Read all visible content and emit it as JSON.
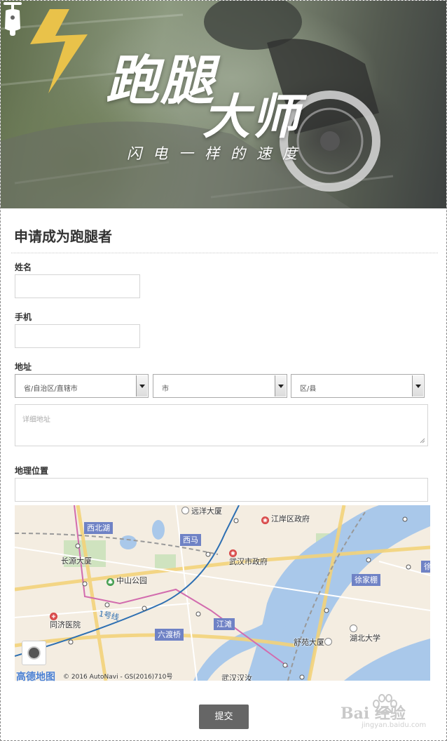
{
  "banner": {
    "title_line1": "跑腿",
    "title_line2": "大师",
    "slogan": "闪电一样的速度"
  },
  "form": {
    "title": "申请成为跑腿者",
    "name_label": "姓名",
    "phone_label": "手机",
    "address_label": "地址",
    "province_select": "省/自治区/直辖市",
    "city_select": "市",
    "district_select": "区/县",
    "detail_address_placeholder": "详细地址",
    "location_label": "地理位置",
    "submit_label": "提交"
  },
  "map": {
    "places": {
      "xibeihu": "西北湖",
      "yuanyang": "远洋大厦",
      "jiangan_gov": "江岸区政府",
      "xima": "西马",
      "changyuan": "长源大厦",
      "wuhan_gov": "武汉市政府",
      "zhongshan_park": "中山公园",
      "xujiapeng": "徐家棚",
      "tongji_hospital": "同济医院",
      "jiangtan": "江滩",
      "liudu_bridge": "六渡桥",
      "shuyuan": "舒苑大厦",
      "hubei_univ": "湖北大学",
      "jiedao": "武汉汉汝",
      "edge_stub": "徐"
    },
    "metro_line": "1号线",
    "logo": "高德地图",
    "copyright": "© 2016 AutoNavi - GS(2016)710号"
  },
  "watermark": {
    "text": "Bai 经验",
    "sub": "jingyan.baidu.com"
  }
}
